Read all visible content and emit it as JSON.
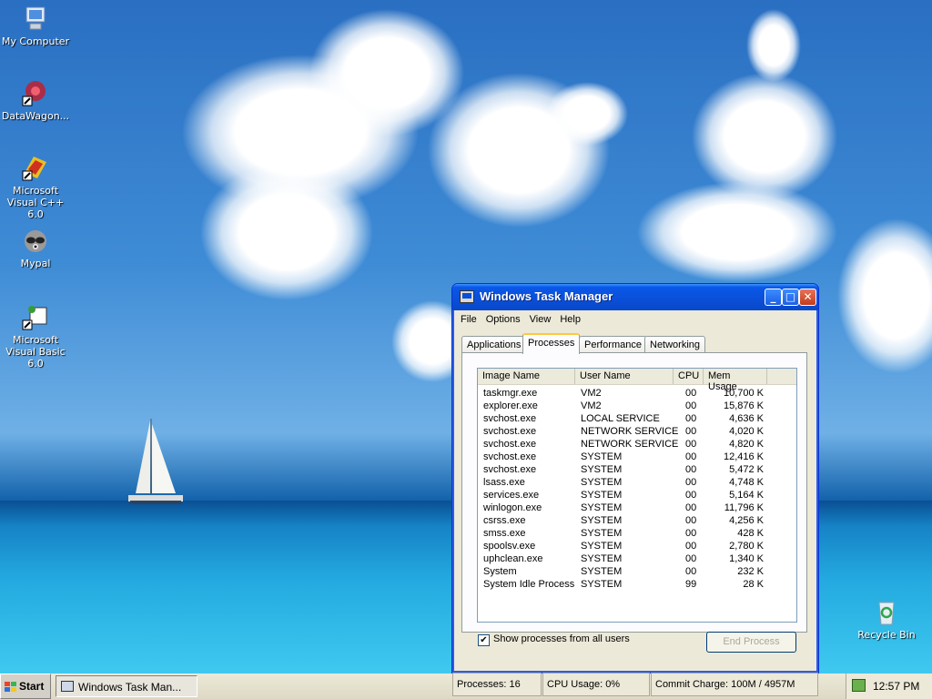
{
  "desktop": {
    "icons": [
      {
        "label": "My Computer"
      },
      {
        "label": "DataWagon..."
      },
      {
        "label": "Microsoft Visual C++ 6.0"
      },
      {
        "label": "Mypal"
      },
      {
        "label": "Microsoft Visual Basic 6.0"
      },
      {
        "label": "Recycle Bin"
      }
    ]
  },
  "window": {
    "title": "Windows Task Manager",
    "controls": {
      "minimize": "_",
      "maximize": "□",
      "close": "✕"
    },
    "menu": [
      "File",
      "Options",
      "View",
      "Help"
    ],
    "tabs": [
      "Applications",
      "Processes",
      "Performance",
      "Networking"
    ],
    "active_tab": "Processes",
    "columns": [
      "Image Name",
      "User Name",
      "CPU",
      "Mem Usage"
    ],
    "processes": [
      {
        "name": "taskmgr.exe",
        "user": "VM2",
        "cpu": "00",
        "mem": "10,700 K"
      },
      {
        "name": "explorer.exe",
        "user": "VM2",
        "cpu": "00",
        "mem": "15,876 K"
      },
      {
        "name": "svchost.exe",
        "user": "LOCAL SERVICE",
        "cpu": "00",
        "mem": "4,636 K"
      },
      {
        "name": "svchost.exe",
        "user": "NETWORK SERVICE",
        "cpu": "00",
        "mem": "4,020 K"
      },
      {
        "name": "svchost.exe",
        "user": "NETWORK SERVICE",
        "cpu": "00",
        "mem": "4,820 K"
      },
      {
        "name": "svchost.exe",
        "user": "SYSTEM",
        "cpu": "00",
        "mem": "12,416 K"
      },
      {
        "name": "svchost.exe",
        "user": "SYSTEM",
        "cpu": "00",
        "mem": "5,472 K"
      },
      {
        "name": "lsass.exe",
        "user": "SYSTEM",
        "cpu": "00",
        "mem": "4,748 K"
      },
      {
        "name": "services.exe",
        "user": "SYSTEM",
        "cpu": "00",
        "mem": "5,164 K"
      },
      {
        "name": "winlogon.exe",
        "user": "SYSTEM",
        "cpu": "00",
        "mem": "11,796 K"
      },
      {
        "name": "csrss.exe",
        "user": "SYSTEM",
        "cpu": "00",
        "mem": "4,256 K"
      },
      {
        "name": "smss.exe",
        "user": "SYSTEM",
        "cpu": "00",
        "mem": "428 K"
      },
      {
        "name": "spoolsv.exe",
        "user": "SYSTEM",
        "cpu": "00",
        "mem": "2,780 K"
      },
      {
        "name": "uphclean.exe",
        "user": "SYSTEM",
        "cpu": "00",
        "mem": "1,340 K"
      },
      {
        "name": "System",
        "user": "SYSTEM",
        "cpu": "00",
        "mem": "232 K"
      },
      {
        "name": "System Idle Process",
        "user": "SYSTEM",
        "cpu": "99",
        "mem": "28 K"
      }
    ],
    "show_all_label": "Show processes from all users",
    "show_all_checked": true,
    "end_process_label": "End Process"
  },
  "statusbar": {
    "processes": "Processes: 16",
    "cpu": "CPU Usage: 0%",
    "commit": "Commit Charge: 100M / 4957M"
  },
  "taskbar": {
    "start_label": "Start",
    "task_button_label": "Windows Task Man...",
    "clock": "12:57 PM"
  },
  "colors": {
    "titlebar": "#0a4fd8",
    "taskbar": "#ece9d8",
    "active_tab_accent": "#ffc83c"
  }
}
